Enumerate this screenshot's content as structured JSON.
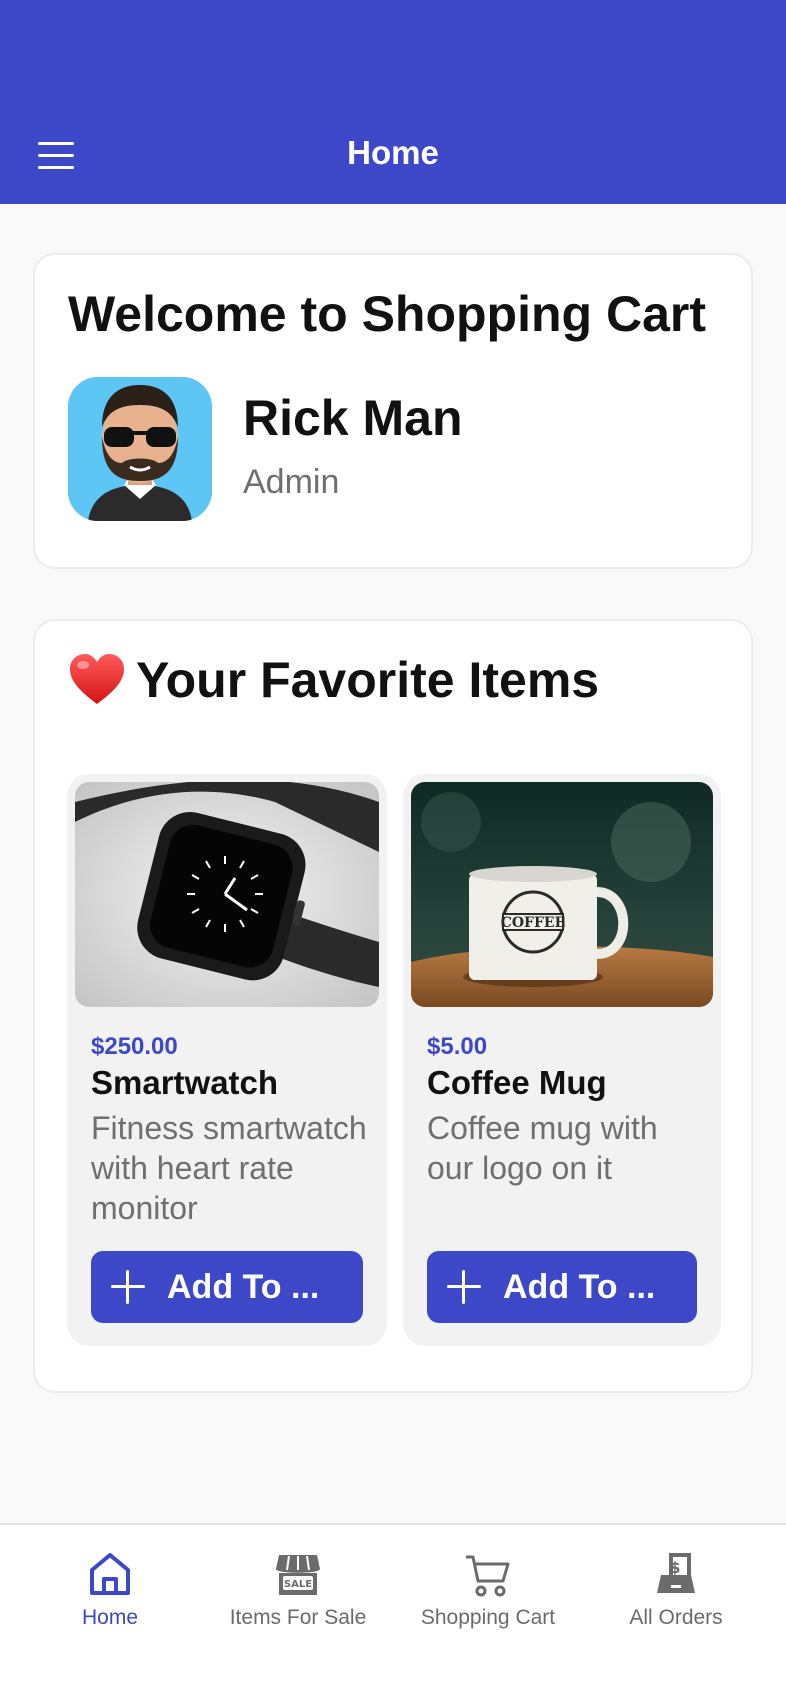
{
  "header": {
    "title": "Home",
    "menu_icon": "hamburger-menu-icon"
  },
  "welcome": {
    "title": "Welcome to Shopping Cart",
    "user_name": "Rick Man",
    "user_role": "Admin"
  },
  "favorites": {
    "title": "Your Favorite Items",
    "title_icon": "heart-icon",
    "items": [
      {
        "price": "$250.00",
        "name": "Smartwatch",
        "description": "Fitness smartwatch with heart rate monitor",
        "button_label": "Add To ..."
      },
      {
        "price": "$5.00",
        "name": "Coffee Mug",
        "description": "Coffee mug with our logo on it",
        "button_label": "Add To ..."
      }
    ]
  },
  "bottom_nav": {
    "items": [
      {
        "label": "Home",
        "icon": "home-icon",
        "active": true
      },
      {
        "label": "Items For Sale",
        "icon": "sale-store-icon",
        "active": false
      },
      {
        "label": "Shopping Cart",
        "icon": "cart-icon",
        "active": false
      },
      {
        "label": "All Orders",
        "icon": "orders-icon",
        "active": false
      }
    ]
  },
  "colors": {
    "primary": "#3c48c7",
    "background": "#f9f9f9",
    "muted_text": "#6f6f6f"
  }
}
